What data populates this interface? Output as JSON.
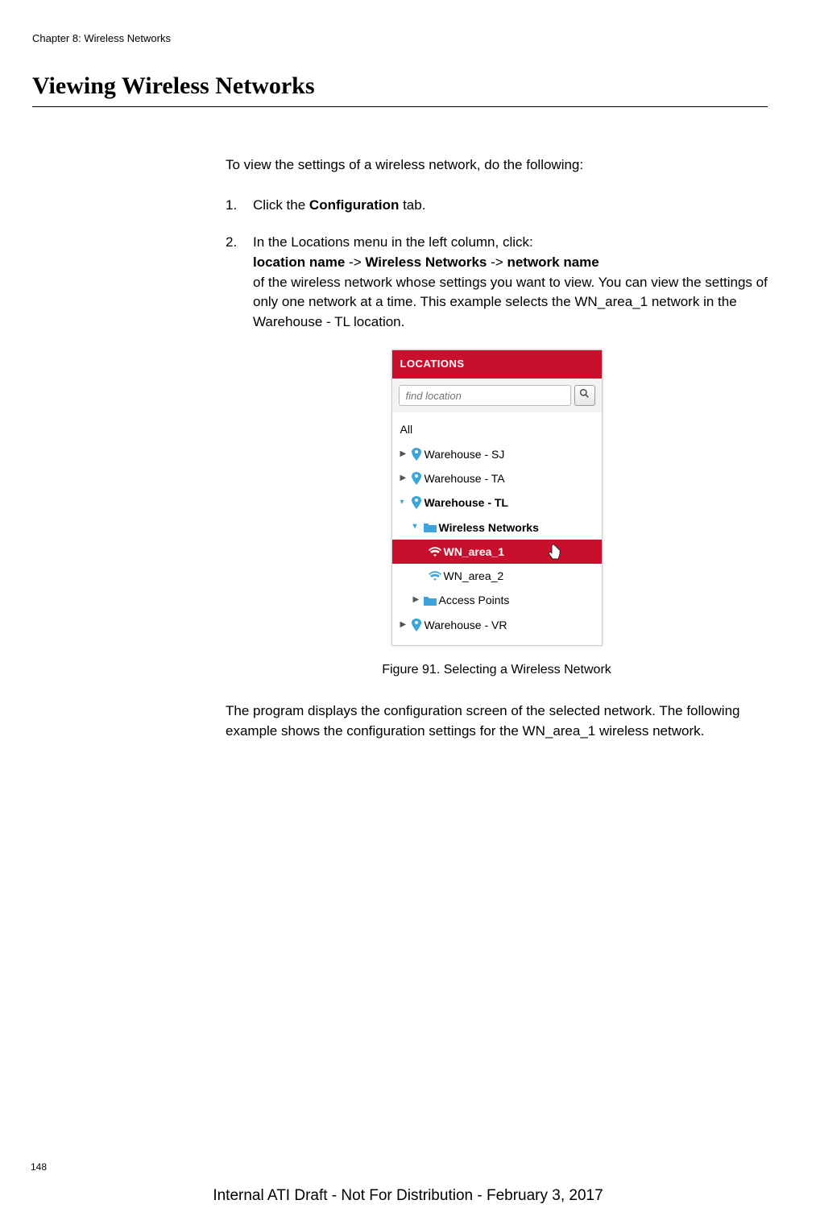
{
  "chapter": "Chapter 8: Wireless Networks",
  "section_title": "Viewing Wireless Networks",
  "intro": "To view the settings of a wireless network, do the following:",
  "steps": [
    {
      "num": "1.",
      "pre": "Click the ",
      "bold1": "Configuration",
      "post": " tab."
    }
  ],
  "step2": {
    "num": "2.",
    "line1": "In the Locations menu in the left column, click:",
    "b1": "location name",
    "arrow1": " -> ",
    "b2": "Wireless Networks",
    "arrow2": " -> ",
    "b3": "network name",
    "rest": "of the wireless network whose settings you want to view. You can view the settings of only one network at a time. This example selects the WN_area_1 network in the Warehouse - TL location."
  },
  "panel": {
    "header": "LOCATIONS",
    "search_placeholder": "find location",
    "all": "All",
    "items": {
      "sj": "Warehouse - SJ",
      "ta": "Warehouse - TA",
      "tl": "Warehouse - TL",
      "wireless_networks": "Wireless Networks",
      "wn1": "WN_area_1",
      "wn2": "WN_area_2",
      "ap": "Access Points",
      "vr": "Warehouse - VR"
    }
  },
  "figure_caption": "Figure 91. Selecting a Wireless Network",
  "result_text": "The program displays the configuration screen of the selected network. The following example shows the configuration settings for the WN_area_1 wireless network.",
  "page_number": "148",
  "footer": "Internal ATI Draft - Not For Distribution - February 3, 2017"
}
